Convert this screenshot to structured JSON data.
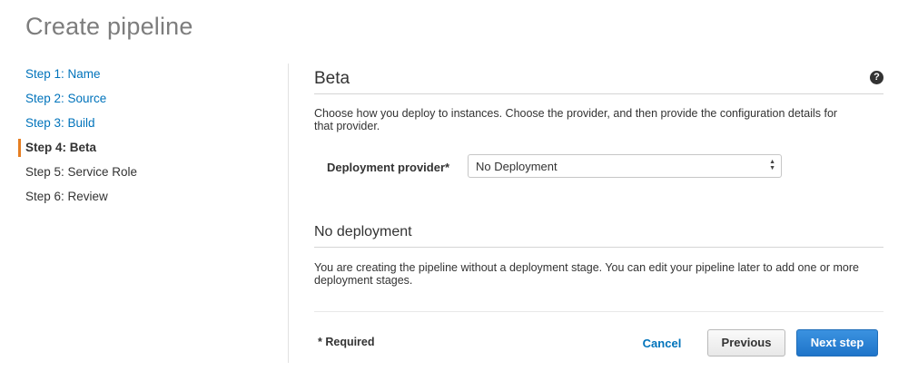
{
  "page": {
    "title": "Create pipeline"
  },
  "steps": [
    {
      "label": "Step 1: Name",
      "state": "link"
    },
    {
      "label": "Step 2: Source",
      "state": "link"
    },
    {
      "label": "Step 3: Build",
      "state": "link"
    },
    {
      "label": "Step 4: Beta",
      "state": "active"
    },
    {
      "label": "Step 5: Service Role",
      "state": "upcoming"
    },
    {
      "label": "Step 6: Review",
      "state": "upcoming"
    }
  ],
  "section": {
    "title": "Beta",
    "help_icon": "question-circle-icon",
    "description": "Choose how you deploy to instances. Choose the provider, and then provide the configuration details for that provider."
  },
  "provider": {
    "label": "Deployment provider*",
    "selected": "No Deployment"
  },
  "no_deployment": {
    "title": "No deployment",
    "description": "You are creating the pipeline without a deployment stage. You can edit your pipeline later to add one or more deployment stages."
  },
  "footer": {
    "required_label": "* Required",
    "cancel_label": "Cancel",
    "previous_label": "Previous",
    "next_label": "Next step"
  },
  "colors": {
    "link": "#0073bb",
    "active_marker": "#e67e22",
    "primary_button": "#1f74c9"
  }
}
